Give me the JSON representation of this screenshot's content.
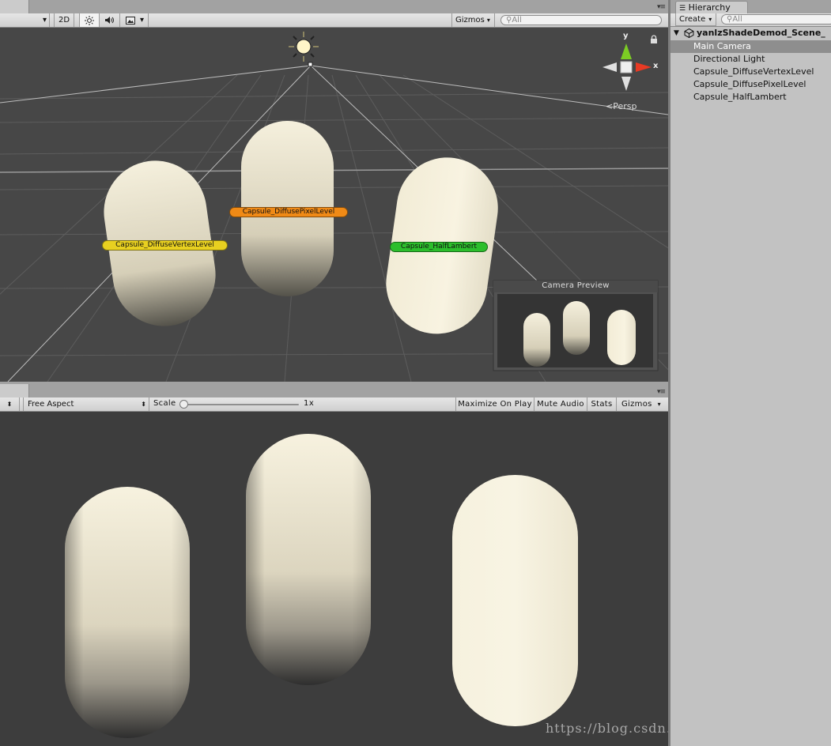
{
  "scene": {
    "toolbar": {
      "mode_2d": "2D",
      "sun_icon": "sun-icon",
      "audio_icon": "speaker-icon",
      "image_icon": "image-icon",
      "gizmos_label": "Gizmos",
      "search_placeholder": "All"
    },
    "gizmo": {
      "y_label": "y",
      "x_label": "x",
      "projection_label": "Persp"
    },
    "object_labels": [
      {
        "text": "Capsule_DiffuseVertexLevel",
        "color": "#e8d020"
      },
      {
        "text": "Capsule_DiffusePixelLevel",
        "color": "#f08a16"
      },
      {
        "text": "Capsule_HalfLambert",
        "color": "#2cbe2c"
      }
    ],
    "camera_preview_title": "Camera Preview"
  },
  "game": {
    "toolbar": {
      "aspect": "Free Aspect",
      "scale_label": "Scale",
      "scale_value": "1x",
      "scale_level": 0,
      "maximize": "Maximize On Play",
      "mute": "Mute Audio",
      "stats": "Stats",
      "gizmos": "Gizmos"
    }
  },
  "hierarchy": {
    "tab_label": "Hierarchy",
    "create_label": "Create",
    "search_placeholder": "All",
    "scene_name": "yanlzShadeDemod_Scene_",
    "items": [
      {
        "label": "Main Camera",
        "selected": true
      },
      {
        "label": "Directional Light",
        "selected": false
      },
      {
        "label": "Capsule_DiffuseVertexLevel",
        "selected": false
      },
      {
        "label": "Capsule_DiffusePixelLevel",
        "selected": false
      },
      {
        "label": "Capsule_HalfLambert",
        "selected": false
      }
    ]
  },
  "colors": {
    "capsule": "#f4efdc",
    "selection_row": "#8e8e8e",
    "axis_y": "#7ccc24",
    "axis_x": "#e83a24"
  },
  "watermark": "https://blog.csdn.net/VRunSoftYanlz"
}
